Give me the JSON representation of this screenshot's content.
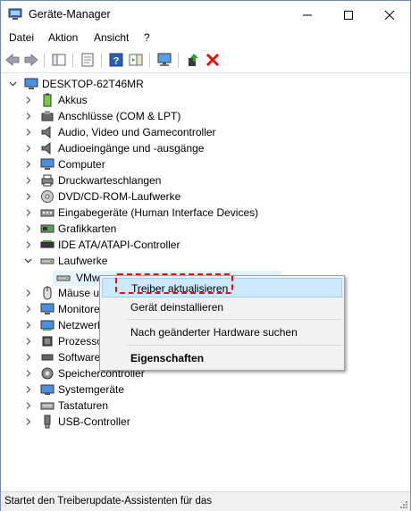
{
  "window": {
    "title": "Geräte-Manager"
  },
  "menu": [
    "Datei",
    "Aktion",
    "Ansicht",
    "?"
  ],
  "tree": {
    "root": "DESKTOP-62T46MR",
    "categories": [
      "Akkus",
      "Anschlüsse (COM & LPT)",
      "Audio, Video und Gamecontroller",
      "Audioeingänge und -ausgänge",
      "Computer",
      "Druckwarteschlangen",
      "DVD/CD-ROM-Laufwerke",
      "Eingabegeräte (Human Interface Devices)",
      "Grafikkarten",
      "IDE ATA/ATAPI-Controller",
      "Laufwerke",
      "VMw",
      "Mäuse u",
      "Monitore",
      "Netzwerk",
      "Prozesso",
      "Software",
      "Speichercontroller",
      "Systemgeräte",
      "Tastaturen",
      "USB-Controller"
    ]
  },
  "context_menu": {
    "items": [
      "Treiber aktualisieren",
      "Gerät deinstallieren",
      "Nach geänderter Hardware suchen",
      "Eigenschaften"
    ]
  },
  "status": {
    "text": "Startet den Treiberupdate-Assistenten für das"
  },
  "colors": {
    "highlight_border": "#e01010",
    "menu_hover": "#cde8ff"
  }
}
